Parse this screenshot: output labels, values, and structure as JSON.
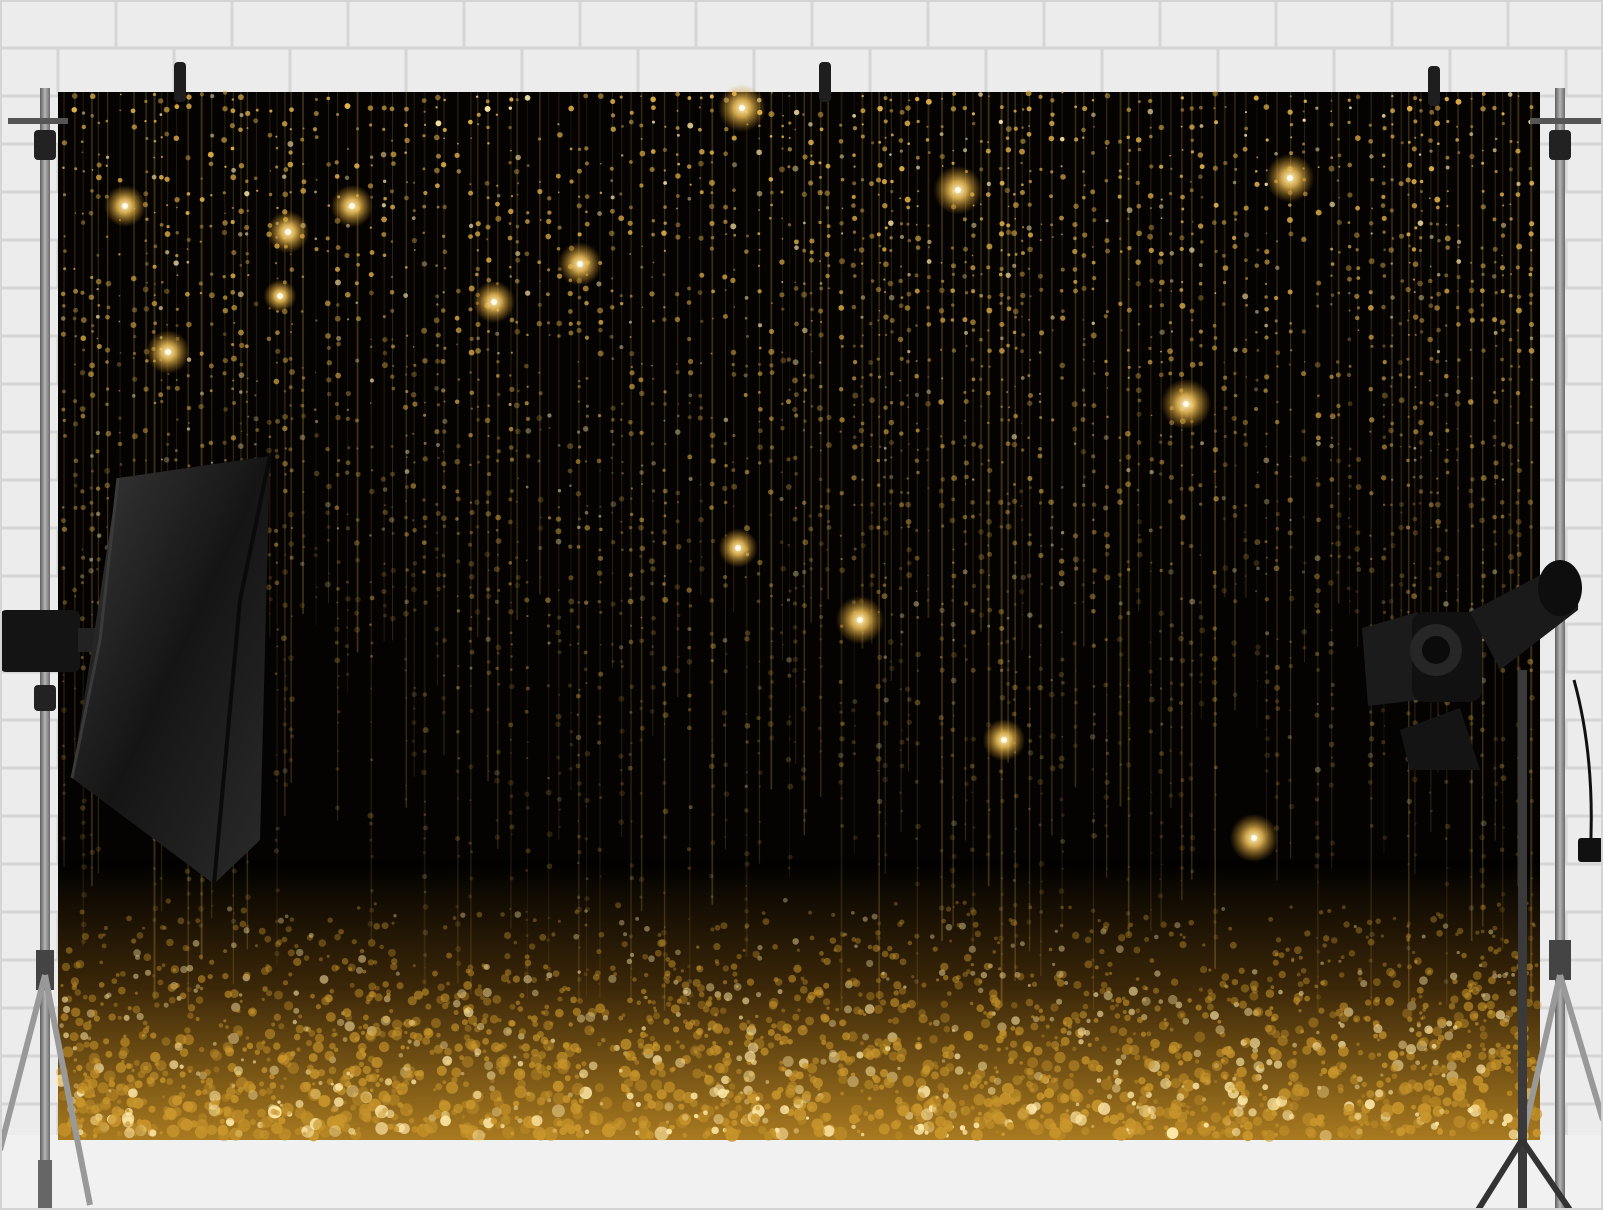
{
  "scene": {
    "description_kind": "photography studio product photo",
    "colors": {
      "wall": "#ececec",
      "wall_mortar": "#d6d6d6",
      "floor": "#f2f2f2",
      "backdrop_base": "#050302",
      "sparkle_gold": "#e9b64a",
      "sparkle_light": "#ffe9a8",
      "glitter_floor": "#c9962c",
      "equipment": "#1a1a1a",
      "stand_metal": "#8d8d8d"
    },
    "icons": [
      "softbox-light-icon",
      "spotlight-icon",
      "backdrop-clip-icon",
      "light-stand-icon"
    ]
  }
}
